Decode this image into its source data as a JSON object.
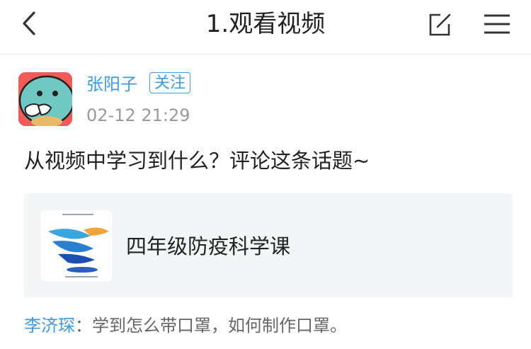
{
  "header": {
    "title": "1.观看视频",
    "back_icon": "chevron-left-icon",
    "edit_icon": "edit-icon",
    "menu_icon": "hamburger-menu-icon"
  },
  "post": {
    "author": "张阳子",
    "follow_label": "关注",
    "time": "02-12 21:29",
    "text": "从视频中学习到什么？评论这条话题~",
    "attachment": {
      "title": "四年级防疫科学课",
      "icon": "bird-logo"
    }
  },
  "comment": {
    "author": "李济琛",
    "separator": "：",
    "text": "学到怎么带口罩，如何制作口罩。"
  },
  "colors": {
    "accent": "#3d9be0",
    "avatar_bg": "#f05a58",
    "card_bg": "#f4f5f7"
  }
}
